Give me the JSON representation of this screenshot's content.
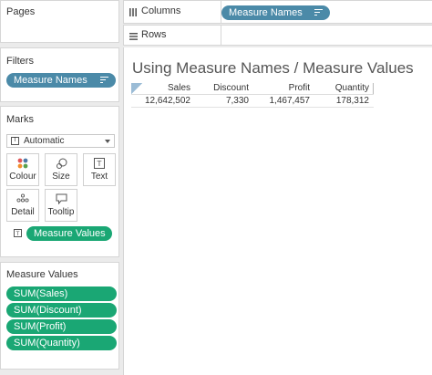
{
  "pages": {
    "title": "Pages"
  },
  "columns": {
    "label": "Columns",
    "pill": "Measure Names"
  },
  "rows": {
    "label": "Rows"
  },
  "filters": {
    "title": "Filters",
    "pill": "Measure Names"
  },
  "marks": {
    "title": "Marks",
    "mark_type": "Automatic",
    "buttons": [
      {
        "label": "Colour",
        "icon": "colour-dots-icon"
      },
      {
        "label": "Size",
        "icon": "size-icon"
      },
      {
        "label": "Text",
        "icon": "text-icon"
      },
      {
        "label": "Detail",
        "icon": "detail-dots-icon"
      },
      {
        "label": "Tooltip",
        "icon": "tooltip-icon"
      }
    ],
    "text_pill": "Measure Values"
  },
  "measure_values": {
    "title": "Measure Values",
    "items": [
      "SUM(Sales)",
      "SUM(Discount)",
      "SUM(Profit)",
      "SUM(Quantity)"
    ]
  },
  "view": {
    "title": "Using Measure Names / Measure Values",
    "headers": [
      "Sales",
      "Discount",
      "Profit",
      "Quantity"
    ],
    "values": [
      "12,642,502",
      "7,330",
      "1,467,457",
      "178,312"
    ]
  },
  "colors": {
    "blue_pill": "#4b8aa8",
    "green_pill": "#1aa774"
  }
}
